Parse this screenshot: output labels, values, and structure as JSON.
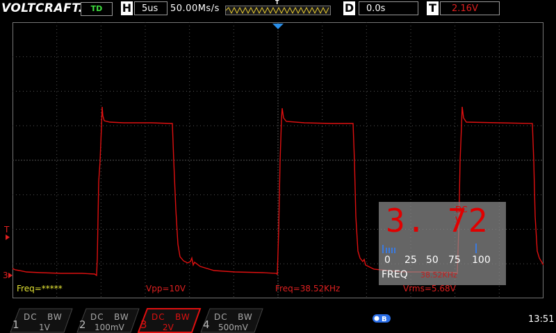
{
  "header": {
    "brand": "VOLTCRAFT.",
    "mode": "TD",
    "horizontal": {
      "letter": "H",
      "value": "5us"
    },
    "sample_rate": "50.00Ms/s",
    "trigger_strip": {
      "label": "T"
    },
    "delay": {
      "letter": "D",
      "value": "0.0s"
    },
    "trigger": {
      "letter": "T",
      "value": "2.16V"
    }
  },
  "markers": {
    "trigger_level": "T",
    "channel": "3"
  },
  "measurements": {
    "freq1": "Freq=*****",
    "vpp": "Vpp=10V",
    "freq2": "Freq=38.52KHz",
    "vrms": "Vrms=5.68V"
  },
  "multimeter": {
    "reading": "3. 72",
    "coupling": "DC",
    "unit": "V",
    "scale": [
      "0",
      "25",
      "50",
      "75",
      "100"
    ],
    "mode_label": "FREQ",
    "freq_value": "38.52KHz",
    "bar_level_percent": 7
  },
  "channels": [
    {
      "num": "1",
      "coupling": "DC",
      "bw": "BW",
      "scale": "1V",
      "active": false
    },
    {
      "num": "2",
      "coupling": "DC",
      "bw": "BW",
      "scale": "100mV",
      "active": false
    },
    {
      "num": "3",
      "coupling": "DC",
      "bw": "BW",
      "scale": "2V",
      "active": true
    },
    {
      "num": "4",
      "coupling": "DC",
      "bw": "BW",
      "scale": "500mV",
      "active": false
    }
  ],
  "status": {
    "time": "13:51",
    "usb_icon": "usb-icon"
  },
  "colors": {
    "trace": "#e01010",
    "measure_yellow": "#e5e534",
    "accent_blue": "#2a8ee8"
  }
}
